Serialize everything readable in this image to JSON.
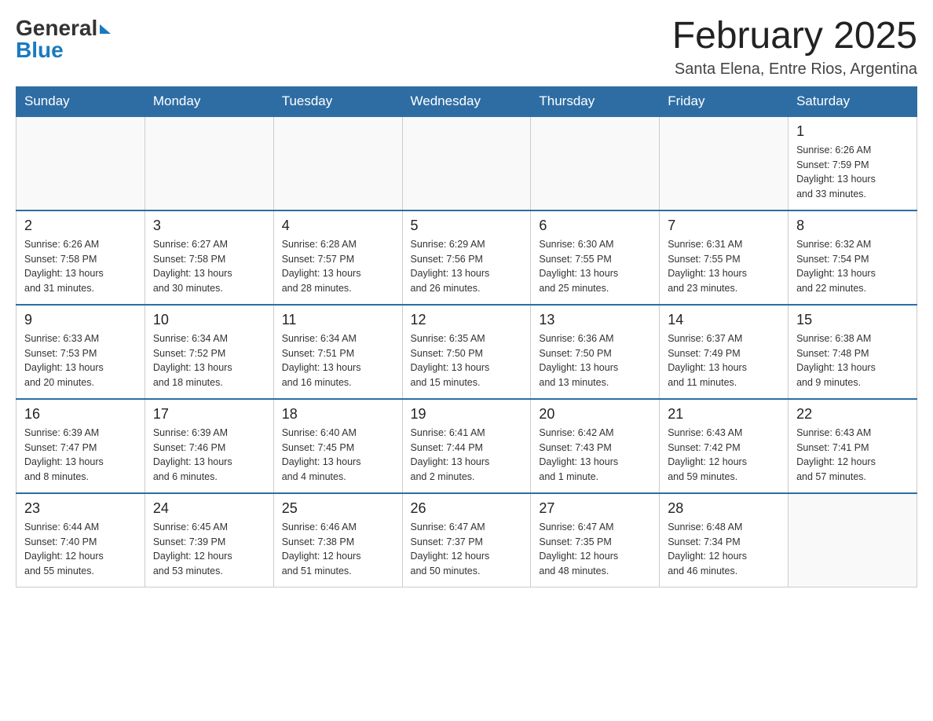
{
  "header": {
    "logo_general": "General",
    "logo_blue": "Blue",
    "month_title": "February 2025",
    "location": "Santa Elena, Entre Rios, Argentina"
  },
  "weekdays": [
    "Sunday",
    "Monday",
    "Tuesday",
    "Wednesday",
    "Thursday",
    "Friday",
    "Saturday"
  ],
  "weeks": [
    [
      {
        "day": "",
        "info": ""
      },
      {
        "day": "",
        "info": ""
      },
      {
        "day": "",
        "info": ""
      },
      {
        "day": "",
        "info": ""
      },
      {
        "day": "",
        "info": ""
      },
      {
        "day": "",
        "info": ""
      },
      {
        "day": "1",
        "info": "Sunrise: 6:26 AM\nSunset: 7:59 PM\nDaylight: 13 hours\nand 33 minutes."
      }
    ],
    [
      {
        "day": "2",
        "info": "Sunrise: 6:26 AM\nSunset: 7:58 PM\nDaylight: 13 hours\nand 31 minutes."
      },
      {
        "day": "3",
        "info": "Sunrise: 6:27 AM\nSunset: 7:58 PM\nDaylight: 13 hours\nand 30 minutes."
      },
      {
        "day": "4",
        "info": "Sunrise: 6:28 AM\nSunset: 7:57 PM\nDaylight: 13 hours\nand 28 minutes."
      },
      {
        "day": "5",
        "info": "Sunrise: 6:29 AM\nSunset: 7:56 PM\nDaylight: 13 hours\nand 26 minutes."
      },
      {
        "day": "6",
        "info": "Sunrise: 6:30 AM\nSunset: 7:55 PM\nDaylight: 13 hours\nand 25 minutes."
      },
      {
        "day": "7",
        "info": "Sunrise: 6:31 AM\nSunset: 7:55 PM\nDaylight: 13 hours\nand 23 minutes."
      },
      {
        "day": "8",
        "info": "Sunrise: 6:32 AM\nSunset: 7:54 PM\nDaylight: 13 hours\nand 22 minutes."
      }
    ],
    [
      {
        "day": "9",
        "info": "Sunrise: 6:33 AM\nSunset: 7:53 PM\nDaylight: 13 hours\nand 20 minutes."
      },
      {
        "day": "10",
        "info": "Sunrise: 6:34 AM\nSunset: 7:52 PM\nDaylight: 13 hours\nand 18 minutes."
      },
      {
        "day": "11",
        "info": "Sunrise: 6:34 AM\nSunset: 7:51 PM\nDaylight: 13 hours\nand 16 minutes."
      },
      {
        "day": "12",
        "info": "Sunrise: 6:35 AM\nSunset: 7:50 PM\nDaylight: 13 hours\nand 15 minutes."
      },
      {
        "day": "13",
        "info": "Sunrise: 6:36 AM\nSunset: 7:50 PM\nDaylight: 13 hours\nand 13 minutes."
      },
      {
        "day": "14",
        "info": "Sunrise: 6:37 AM\nSunset: 7:49 PM\nDaylight: 13 hours\nand 11 minutes."
      },
      {
        "day": "15",
        "info": "Sunrise: 6:38 AM\nSunset: 7:48 PM\nDaylight: 13 hours\nand 9 minutes."
      }
    ],
    [
      {
        "day": "16",
        "info": "Sunrise: 6:39 AM\nSunset: 7:47 PM\nDaylight: 13 hours\nand 8 minutes."
      },
      {
        "day": "17",
        "info": "Sunrise: 6:39 AM\nSunset: 7:46 PM\nDaylight: 13 hours\nand 6 minutes."
      },
      {
        "day": "18",
        "info": "Sunrise: 6:40 AM\nSunset: 7:45 PM\nDaylight: 13 hours\nand 4 minutes."
      },
      {
        "day": "19",
        "info": "Sunrise: 6:41 AM\nSunset: 7:44 PM\nDaylight: 13 hours\nand 2 minutes."
      },
      {
        "day": "20",
        "info": "Sunrise: 6:42 AM\nSunset: 7:43 PM\nDaylight: 13 hours\nand 1 minute."
      },
      {
        "day": "21",
        "info": "Sunrise: 6:43 AM\nSunset: 7:42 PM\nDaylight: 12 hours\nand 59 minutes."
      },
      {
        "day": "22",
        "info": "Sunrise: 6:43 AM\nSunset: 7:41 PM\nDaylight: 12 hours\nand 57 minutes."
      }
    ],
    [
      {
        "day": "23",
        "info": "Sunrise: 6:44 AM\nSunset: 7:40 PM\nDaylight: 12 hours\nand 55 minutes."
      },
      {
        "day": "24",
        "info": "Sunrise: 6:45 AM\nSunset: 7:39 PM\nDaylight: 12 hours\nand 53 minutes."
      },
      {
        "day": "25",
        "info": "Sunrise: 6:46 AM\nSunset: 7:38 PM\nDaylight: 12 hours\nand 51 minutes."
      },
      {
        "day": "26",
        "info": "Sunrise: 6:47 AM\nSunset: 7:37 PM\nDaylight: 12 hours\nand 50 minutes."
      },
      {
        "day": "27",
        "info": "Sunrise: 6:47 AM\nSunset: 7:35 PM\nDaylight: 12 hours\nand 48 minutes."
      },
      {
        "day": "28",
        "info": "Sunrise: 6:48 AM\nSunset: 7:34 PM\nDaylight: 12 hours\nand 46 minutes."
      },
      {
        "day": "",
        "info": ""
      }
    ]
  ]
}
